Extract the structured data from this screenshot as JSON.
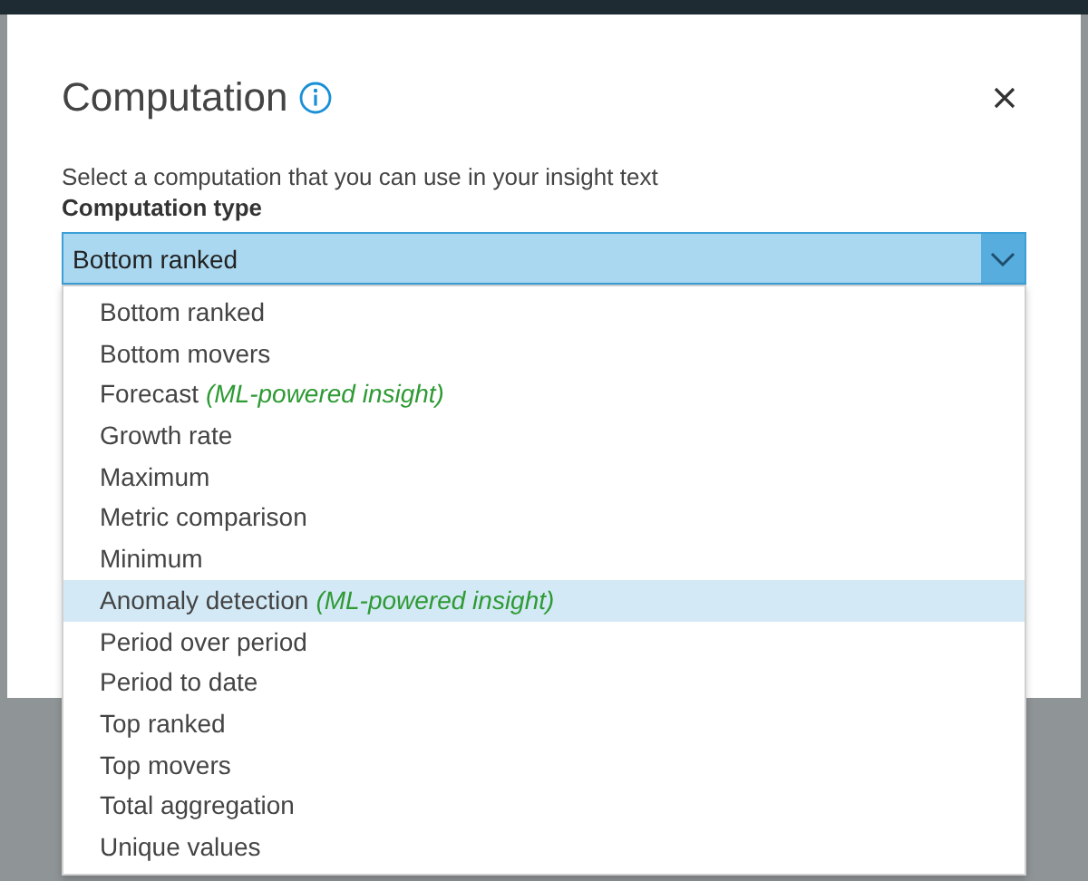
{
  "dialog": {
    "title": "Computation",
    "description": "Select a computation that you can use in your insight text",
    "field_label": "Computation type",
    "select": {
      "value": "Bottom ranked",
      "expanded": true
    },
    "options": [
      {
        "label": "Bottom ranked",
        "selected": false
      },
      {
        "label": "Bottom movers",
        "selected": false
      },
      {
        "label": "Forecast",
        "note": "(ML-powered insight)",
        "selected": false
      },
      {
        "label": "Growth rate",
        "selected": false
      },
      {
        "label": "Maximum",
        "selected": false
      },
      {
        "label": "Metric comparison",
        "selected": false
      },
      {
        "label": "Minimum",
        "selected": false
      },
      {
        "label": "Anomaly detection",
        "note": "(ML-powered insight)",
        "selected": true
      },
      {
        "label": "Period over period",
        "selected": false
      },
      {
        "label": "Period to date",
        "selected": false
      },
      {
        "label": "Top ranked",
        "selected": false
      },
      {
        "label": "Top movers",
        "selected": false
      },
      {
        "label": "Total aggregation",
        "selected": false
      },
      {
        "label": "Unique values",
        "selected": false
      }
    ]
  }
}
